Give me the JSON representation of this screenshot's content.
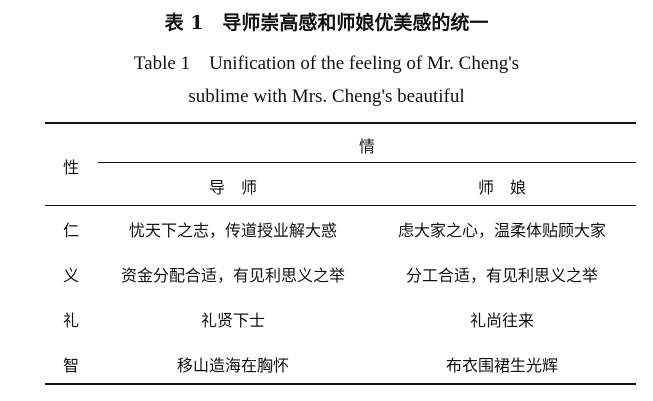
{
  "caption": {
    "cn": "表 1　导师崇高感和师娘优美感的统一",
    "en_line1": "Table 1　Unification of the feeling of Mr. Cheng's",
    "en_line2": "sublime with Mrs. Cheng's beautiful"
  },
  "table": {
    "row_header": "性",
    "group_header": "情",
    "columns": [
      "导　师",
      "师　娘"
    ],
    "rows": [
      {
        "label": "仁",
        "cells": [
          "忧天下之志，传道授业解大惑",
          "虑大家之心，温柔体贴顾大家"
        ]
      },
      {
        "label": "义",
        "cells": [
          "资金分配合适，有见利思义之举",
          "分工合适，有见利思义之举"
        ]
      },
      {
        "label": "礼",
        "cells": [
          "礼贤下士",
          "礼尚往来"
        ]
      },
      {
        "label": "智",
        "cells": [
          "移山造海在胸怀",
          "布衣围裙生光辉"
        ]
      }
    ]
  }
}
